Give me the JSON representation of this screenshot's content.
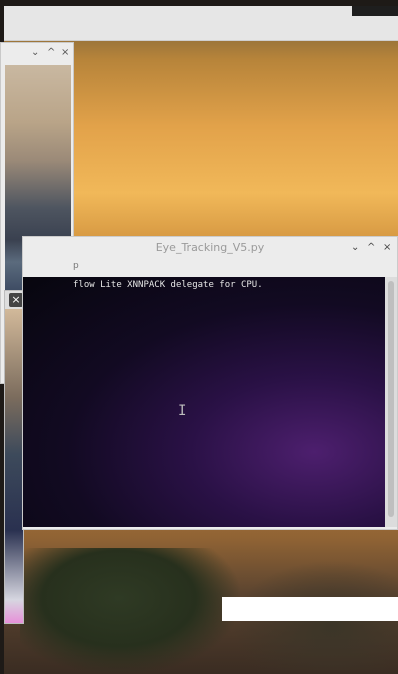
{
  "terminal_window": {
    "title": "Eye_Tracking_V5.py",
    "menu_fragment": "p",
    "output_line": "flow Lite XNNPACK delegate for CPU.",
    "controls": {
      "minimize": "⌄",
      "maximize": "^",
      "close": "×"
    }
  },
  "camera_window_1": {
    "controls": {
      "minimize": "⌄",
      "maximize": "^",
      "close": "×"
    }
  },
  "camera_window_2": {
    "controls": {
      "close": "×"
    }
  },
  "icons": {
    "text_cursor": "I"
  }
}
